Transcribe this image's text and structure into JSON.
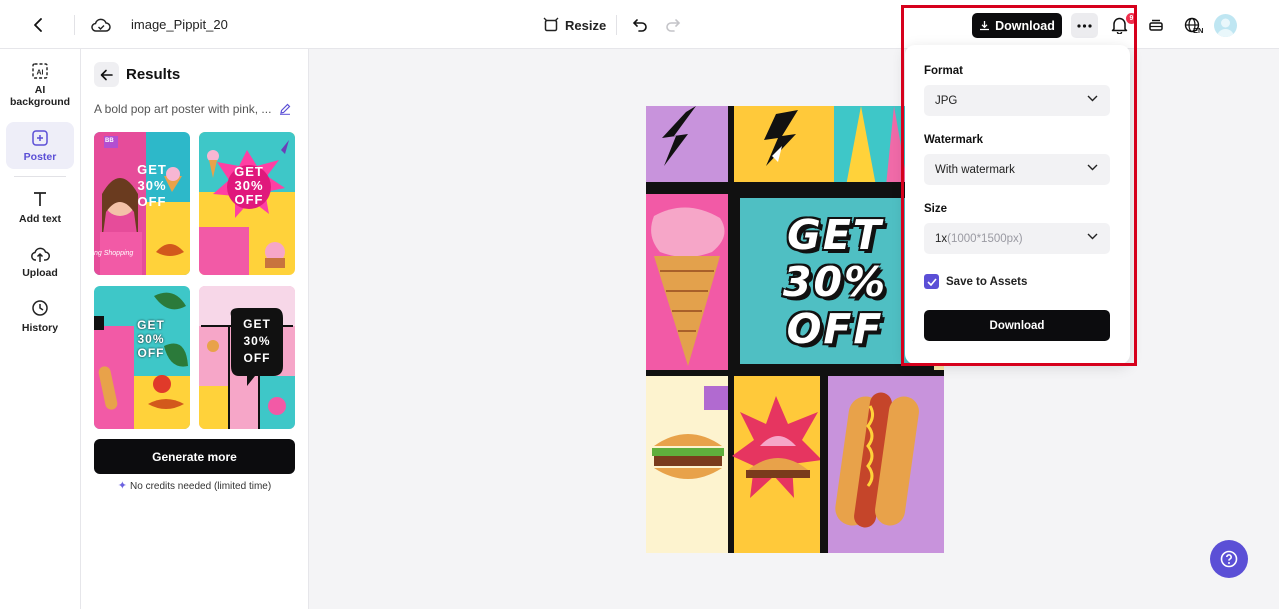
{
  "topbar": {
    "filename": "image_Pippit_20",
    "resize_label": "Resize",
    "download_label": "Download",
    "notification_count": "9",
    "language": "EN"
  },
  "rail": {
    "items": [
      {
        "label": "AI background",
        "icon": "ai-background-icon"
      },
      {
        "label": "Poster",
        "icon": "poster-icon"
      },
      {
        "label": "Add text",
        "icon": "text-icon"
      },
      {
        "label": "Upload",
        "icon": "upload-icon"
      },
      {
        "label": "History",
        "icon": "history-icon"
      }
    ]
  },
  "panel": {
    "title": "Results",
    "prompt": "A bold pop art poster with pink, ...",
    "generate_label": "Generate more",
    "credits_note": "No credits needed (limited time)",
    "thumbnails": [
      {
        "tag": "BB",
        "text": [
          "GET",
          "30%",
          "OFF"
        ],
        "extra": "ng Shopping"
      },
      {
        "text": [
          "GET",
          "30%",
          "OFF"
        ]
      },
      {
        "text": [
          "GET",
          "30%",
          "OFF"
        ]
      },
      {
        "text": [
          "GET",
          "30%",
          "OFF"
        ]
      }
    ]
  },
  "poster": {
    "lines": [
      "GET",
      "30%",
      "OFF"
    ]
  },
  "download_panel": {
    "format_label": "Format",
    "format_value": "JPG",
    "watermark_label": "Watermark",
    "watermark_value": "With watermark",
    "size_label": "Size",
    "size_value": "1x",
    "size_detail": "(1000*1500px)",
    "save_label": "Save to Assets",
    "save_checked": true,
    "download_label": "Download"
  },
  "colors": {
    "accent": "#5b4fd6",
    "primary_button": "#0c0c0e",
    "highlight": "#d6001c",
    "badge": "#f0304e"
  }
}
